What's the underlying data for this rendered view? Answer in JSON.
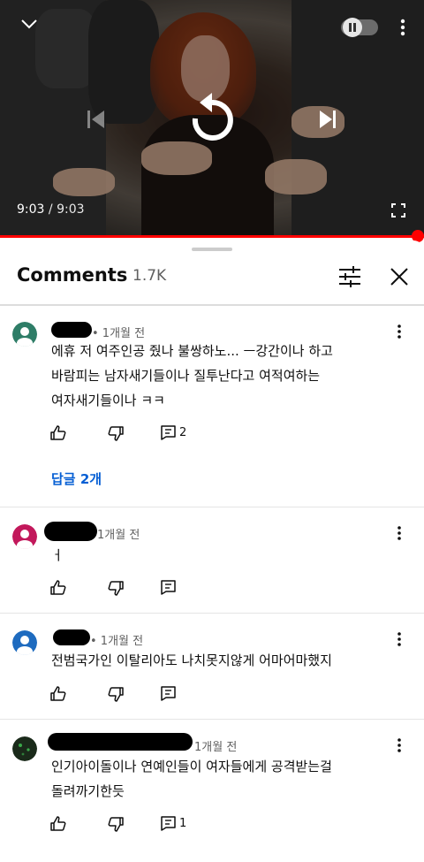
{
  "player": {
    "current_time": "9:03",
    "separator": " / ",
    "duration": "9:03",
    "progress_fraction": 1.0
  },
  "comments_header": {
    "title": "Comments",
    "count": "1.7K"
  },
  "comments": [
    {
      "timestamp": "• 1개월 전",
      "avatar_color": "#2e7d67",
      "lines": [
        "에휴 저 여주인공 줬나 불쌍하노... ㅡ강간이나 하고",
        "바람피는 남자새기들이나 질투난다고 여적여하는",
        "여자새기들이나 ㅋㅋ"
      ],
      "reply_count": "2",
      "replies_label": "답글 2개"
    },
    {
      "timestamp": "1개월 전",
      "avatar_color": "#c2185b",
      "lines": [
        "ㅓ"
      ],
      "reply_count": ""
    },
    {
      "timestamp": "• 1개월 전",
      "avatar_color": "#1e6bbf",
      "lines": [
        "전범국가인 이탈리아도 나치못지않게 어마어마했지"
      ],
      "reply_count": ""
    },
    {
      "timestamp": "1개월 전",
      "avatar_color": "#1a2a1a",
      "lines": [
        "인기아이돌이나 연예인들이 여자들에게 공격받는걸",
        "돌려까기한듯"
      ],
      "reply_count": "1"
    }
  ],
  "colors": {
    "accent_red": "#ff0000",
    "link_blue": "#065fd4",
    "text_primary": "#0f0f0f",
    "text_secondary": "#606060"
  },
  "icons": [
    "chevron-down-icon",
    "autoplay-toggle-icon",
    "more-vert-icon",
    "previous-icon",
    "replay-icon",
    "next-icon",
    "fullscreen-icon",
    "filter-sort-icon",
    "close-icon",
    "like-icon",
    "dislike-icon",
    "reply-icon"
  ]
}
